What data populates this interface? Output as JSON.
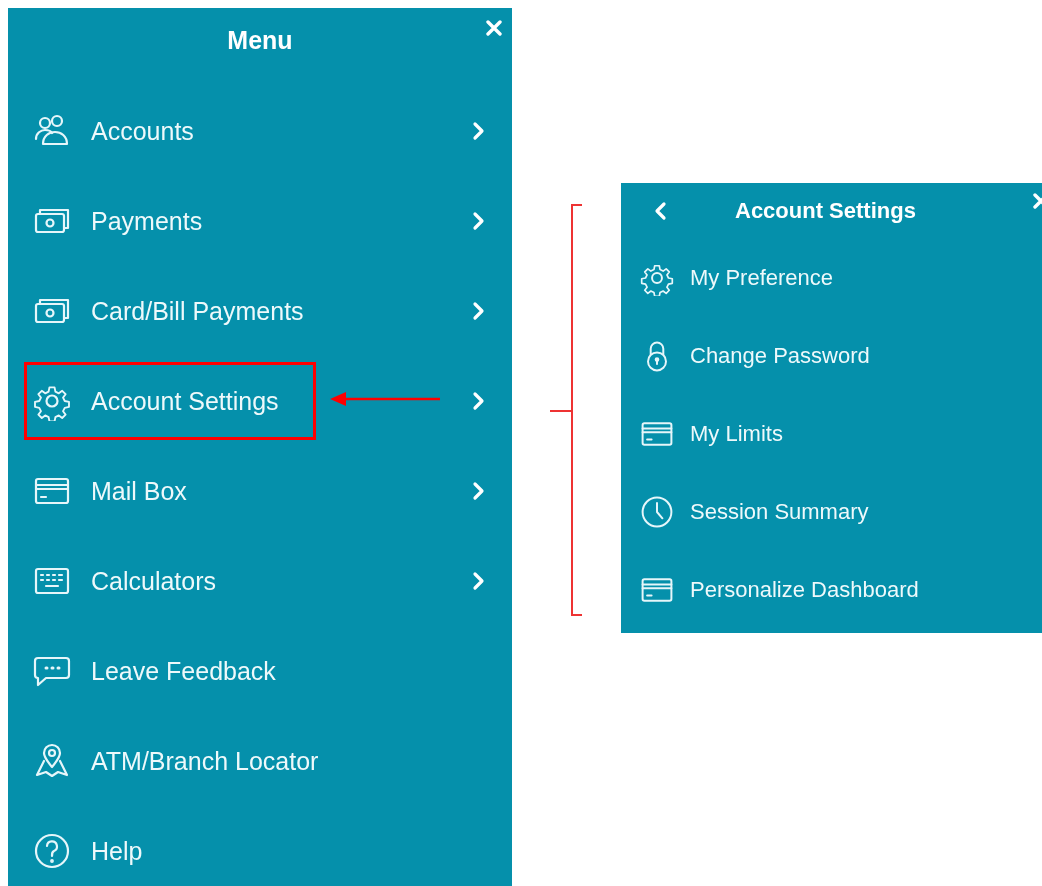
{
  "menu": {
    "title": "Menu",
    "items": [
      {
        "label": "Accounts",
        "kind": "users",
        "submenu": true,
        "annotated": false
      },
      {
        "label": "Payments",
        "kind": "cash",
        "submenu": true,
        "annotated": false
      },
      {
        "label": "Card/Bill Payments",
        "kind": "cash",
        "submenu": true,
        "annotated": false
      },
      {
        "label": "Account Settings",
        "kind": "gear",
        "submenu": true,
        "annotated": true
      },
      {
        "label": "Mail Box",
        "kind": "card",
        "submenu": true,
        "annotated": false
      },
      {
        "label": "Calculators",
        "kind": "keyboard",
        "submenu": true,
        "annotated": false
      },
      {
        "label": "Leave Feedback",
        "kind": "chat",
        "submenu": false,
        "annotated": false
      },
      {
        "label": "ATM/Branch Locator",
        "kind": "map",
        "submenu": false,
        "annotated": false
      },
      {
        "label": "Help",
        "kind": "help",
        "submenu": false,
        "annotated": false
      }
    ]
  },
  "submenu": {
    "title": "Account Settings",
    "items": [
      {
        "label": "My Preference",
        "kind": "gear"
      },
      {
        "label": "Change Password",
        "kind": "lock"
      },
      {
        "label": "My Limits",
        "kind": "card"
      },
      {
        "label": "Session Summary",
        "kind": "clock"
      },
      {
        "label": "Personalize Dashboard",
        "kind": "card"
      }
    ]
  }
}
